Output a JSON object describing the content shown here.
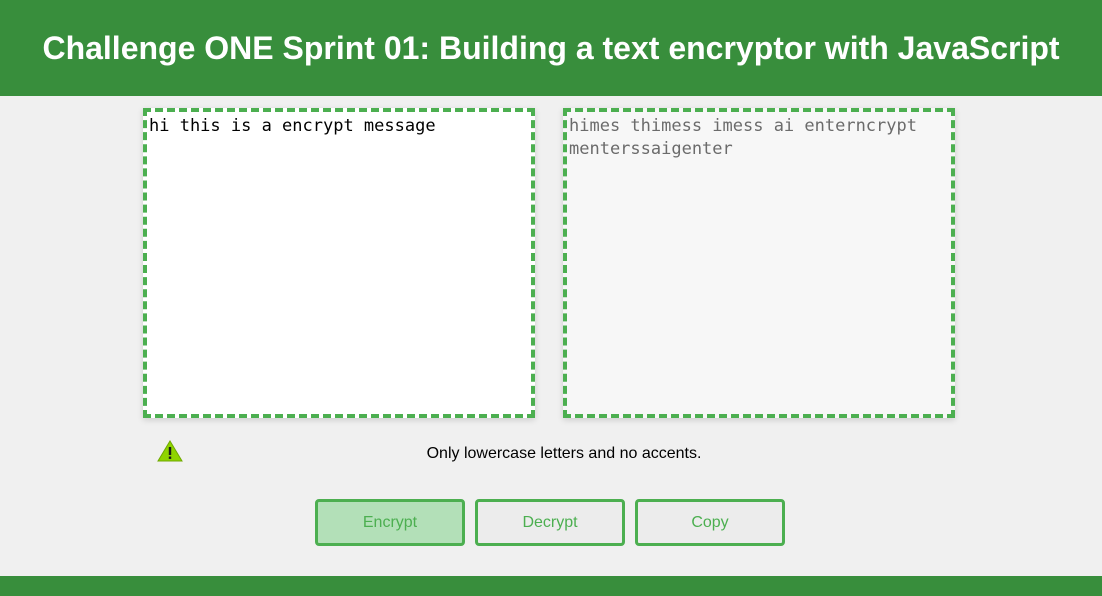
{
  "header": {
    "title": "Challenge ONE Sprint 01: Building a text encryptor with JavaScript"
  },
  "input": {
    "value": "hi this is a encrypt message"
  },
  "output": {
    "value": "himes thimess imess ai enterncrypt menterssaigenter"
  },
  "hint": {
    "icon": "warning-icon",
    "text": "Only lowercase letters and no accents."
  },
  "buttons": {
    "encrypt": "Encrypt",
    "decrypt": "Decrypt",
    "copy": "Copy"
  },
  "colors": {
    "primary_green": "#388e3c",
    "accent_green": "#4caf50",
    "encrypt_button_bg": "#b3e0b8",
    "page_bg": "#f0f0f0",
    "warning_yellow_green": "#8fd400"
  }
}
